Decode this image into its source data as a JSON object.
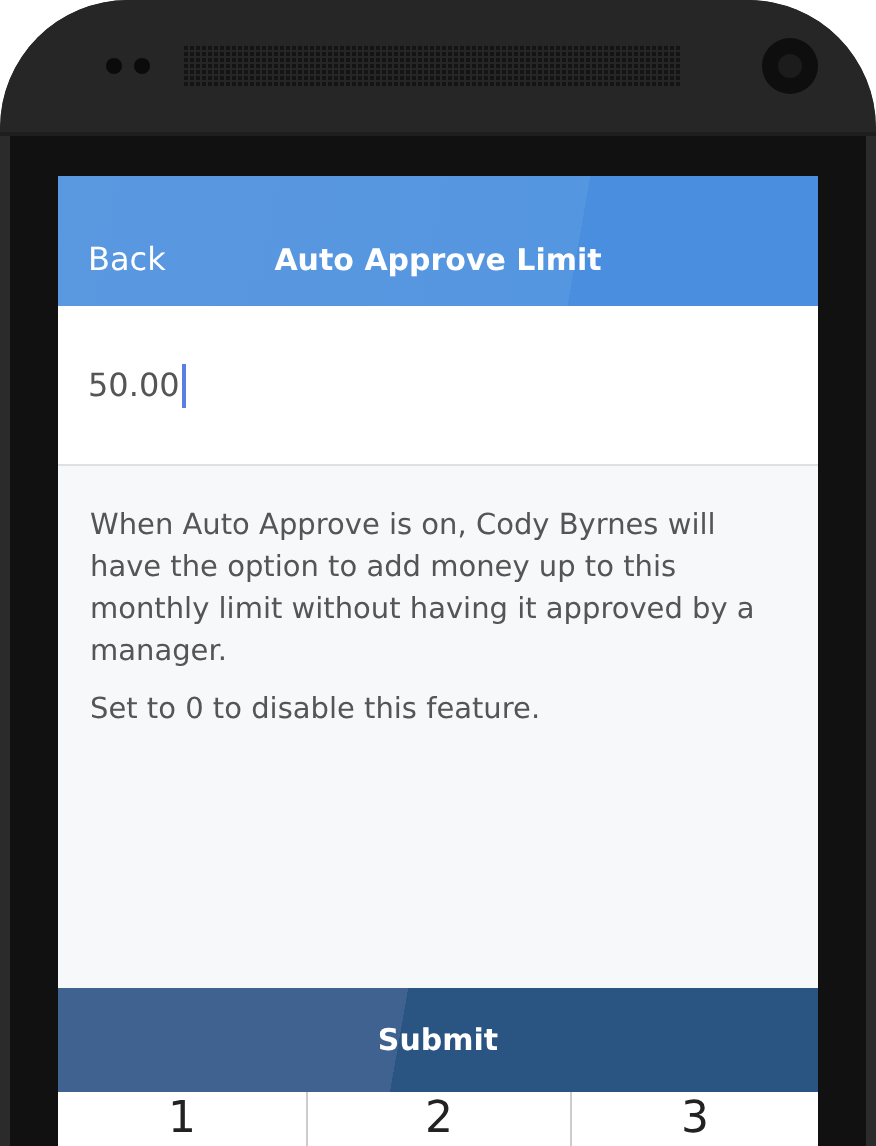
{
  "header": {
    "back": "Back",
    "title": "Auto Approve Limit"
  },
  "limit_field": {
    "value": "50.00"
  },
  "description": [
    "When Auto Approve is on, Cody Byrnes will have the option to add money up to this monthly limit without having it approved by a manager.",
    "Set to 0 to disable this feature."
  ],
  "submit": "Submit",
  "keypad": [
    "1",
    "2",
    "3"
  ]
}
